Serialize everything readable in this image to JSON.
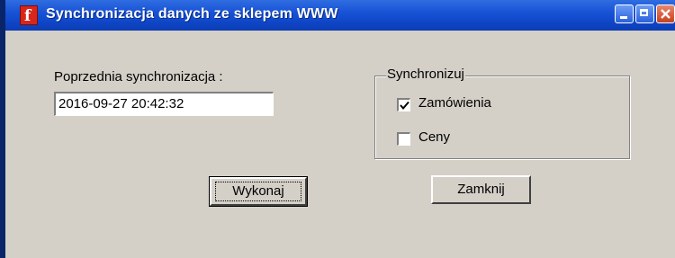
{
  "window": {
    "title": "Synchronizacja danych ze sklepem WWW",
    "app_icon_glyph": "f",
    "controls": [
      "minimize-icon",
      "maximize-icon",
      "close-icon"
    ]
  },
  "last_sync": {
    "label": "Poprzednia synchronizacja :",
    "value": "2016-09-27 20:42:32"
  },
  "sync_group": {
    "legend": "Synchronizuj",
    "options": [
      {
        "label": "Zamówienia",
        "checked": true
      },
      {
        "label": "Ceny",
        "checked": false
      }
    ]
  },
  "buttons": {
    "execute": "Wykonaj",
    "close": "Zamknij"
  },
  "colors": {
    "titlebar": "#1853d6",
    "face": "#d4d0c8",
    "close_button": "#c8401c"
  }
}
